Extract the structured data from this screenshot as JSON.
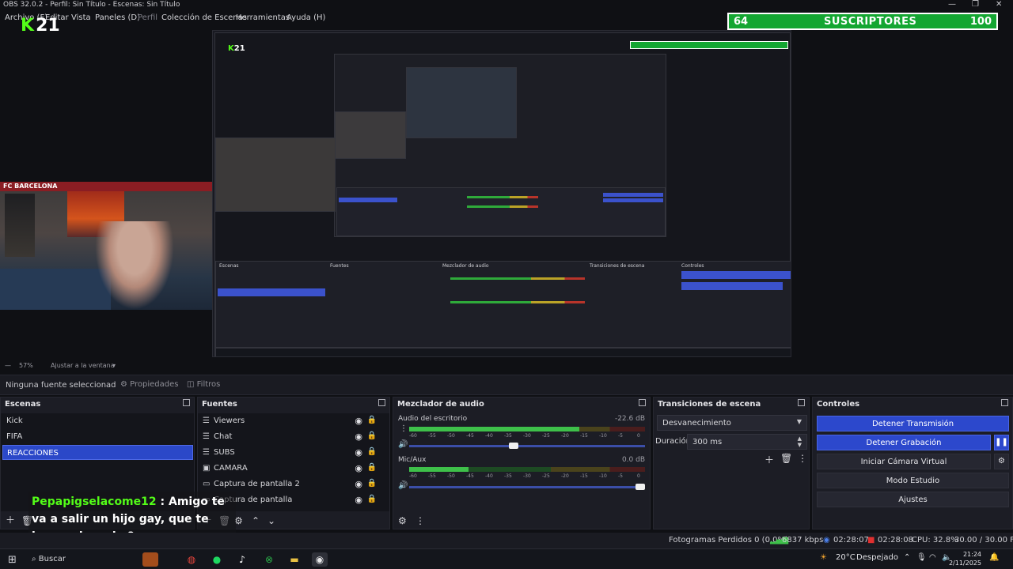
{
  "window": {
    "title": "OBS 32.0.2 - Perfil: Sin Título - Escenas: Sin Título",
    "controls": [
      "—",
      "❐",
      "✕"
    ]
  },
  "menu": [
    "Archivo (F)",
    "Editar",
    "Vista",
    "Paneles (D)",
    "Perfil",
    "Colección de Escenas",
    "Herramientas",
    "Ayuda (H)"
  ],
  "logo": {
    "k": "K",
    "num": "21"
  },
  "subs_widget": {
    "count": "64",
    "label": "SUSCRIPTORES",
    "goal": "100",
    "accent": "#14a632"
  },
  "webcam": {
    "banner": "FC BARCELONA"
  },
  "chat": {
    "user": "Pepapigselacome12",
    "sep": " : ",
    "message": "Amigo te va a salir un hijo gay, que te haces el macho?"
  },
  "zoom": {
    "level": "57%",
    "fit": "Ajustar a la ventana"
  },
  "source_toolbar": {
    "no_source": "Ninguna fuente seleccionad",
    "properties": "Propiedades",
    "filters": "Filtros"
  },
  "scenes": {
    "title": "Escenas",
    "items": [
      "Kick",
      "FIFA",
      "REACCIONES"
    ],
    "selected_index": 2
  },
  "sources": {
    "title": "Fuentes",
    "items": [
      {
        "name": "Viewers",
        "icon": "list-icon"
      },
      {
        "name": "Chat",
        "icon": "list-icon"
      },
      {
        "name": "SUBS",
        "icon": "list-icon"
      },
      {
        "name": "CAMARA",
        "icon": "camera-icon"
      },
      {
        "name": "Captura de pantalla 2",
        "icon": "monitor-icon"
      },
      {
        "name": "Captura de pantalla",
        "icon": "monitor-icon"
      }
    ]
  },
  "mixer": {
    "title": "Mezclador de audio",
    "channels": [
      {
        "name": "Audio del escritorio",
        "db": "-22.6 dB",
        "level": 0.72,
        "volume": 0.44
      },
      {
        "name": "Mic/Aux",
        "db": "0.0 dB",
        "level": 0.25,
        "volume": 1.0
      }
    ],
    "ticks": [
      "-60",
      "-55",
      "-50",
      "-45",
      "-40",
      "-35",
      "-30",
      "-25",
      "-20",
      "-15",
      "-10",
      "-5",
      "0"
    ]
  },
  "transitions": {
    "title": "Transiciones de escena",
    "selected": "Desvanecimiento",
    "duration_label": "Duración",
    "duration_value": "300 ms"
  },
  "controls": {
    "title": "Controles",
    "stop_stream": "Detener Transmisión",
    "stop_record": "Detener Grabación",
    "virtual_cam": "Iniciar Cámara Virtual",
    "studio_mode": "Modo Estudio",
    "settings": "Ajustes"
  },
  "status": {
    "dropped": "Fotogramas Perdidos 0 (0.0%)",
    "bitrate": "6837 kbps",
    "stream_time": "02:28:07",
    "rec_time": "02:28:08",
    "cpu": "CPU: 32.8%",
    "fps": "30.00 / 30.00 FPS"
  },
  "taskbar": {
    "search": "Buscar",
    "weather": "20°C",
    "weather_desc": "Despejado",
    "time": "21:24",
    "date": "2/11/2025"
  },
  "colors": {
    "accent_blue": "#2c48cc",
    "kick_green": "#53fc18"
  }
}
